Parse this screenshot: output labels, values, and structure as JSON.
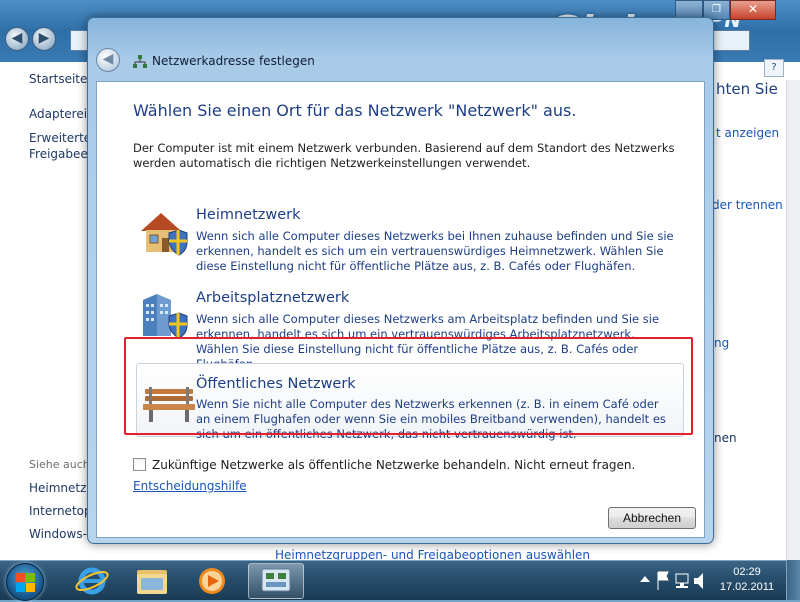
{
  "background": {
    "left_nav": {
      "home_link": "Startseite d",
      "adapter_link": "Adaptereins",
      "advanced_link_1": "Erweiterte",
      "advanced_link_2": "Freigabeein",
      "see_also": "Siehe auch",
      "homegroup_link": "Heimnetzgr",
      "internet_link": "Internetopt",
      "firewall_link": "Windows-F"
    },
    "right_fragments": {
      "title_fragment": "hten Sie",
      "link_show": "t anzeigen",
      "link_disconnect": "der trennen",
      "fragment_ng": "ng",
      "fragment_en": "nen"
    },
    "bottom_link": "Heimnetzgruppen- und Freigabeoptionen auswählen",
    "logo": {
      "main": "Global",
      "sub": "VPN"
    }
  },
  "dialog": {
    "title": "Netzwerkadresse festlegen",
    "heading": "Wählen Sie einen Ort für das Netzwerk \"Netzwerk\" aus.",
    "intro": "Der Computer ist mit einem Netzwerk verbunden. Basierend auf dem Standort des Netzwerks werden automatisch die richtigen Netzwerkeinstellungen verwendet.",
    "options": [
      {
        "title": "Heimnetzwerk",
        "description": "Wenn sich alle Computer dieses Netzwerks bei Ihnen zuhause befinden und Sie sie erkennen, handelt es sich um ein vertrauenswürdiges Heimnetzwerk. Wählen Sie diese Einstellung nicht für öffentliche Plätze aus, z. B. Cafés oder Flughäfen.",
        "icon": "house-shield-icon"
      },
      {
        "title": "Arbeitsplatznetzwerk",
        "description": "Wenn sich alle Computer dieses Netzwerks am Arbeitsplatz befinden und Sie sie erkennen, handelt es sich um ein vertrauenswürdiges Arbeitsplatznetzwerk. Wählen Sie diese Einstellung nicht für öffentliche Plätze aus, z. B. Cafés oder Flughäfen.",
        "icon": "office-building-shield-icon"
      },
      {
        "title": "Öffentliches Netzwerk",
        "description": "Wenn Sie nicht alle Computer des Netzwerks erkennen (z. B. in einem Café oder an einem Flughafen oder wenn Sie ein mobiles Breitband verwenden), handelt es sich um ein öffentliches Netzwerk, das nicht vertrauenswürdig ist.",
        "icon": "park-bench-icon"
      }
    ],
    "checkbox_label": "Zukünftige Netzwerke als öffentliche Netzwerke behandeln. Nicht erneut fragen.",
    "help_link": "Entscheidungshilfe",
    "cancel_button": "Abbrechen"
  },
  "taskbar": {
    "time": "02:29",
    "date": "17.02.2011"
  },
  "colors": {
    "highlight_border": "#e5202a",
    "link": "#1a56b8",
    "heading": "#1d3e84"
  }
}
